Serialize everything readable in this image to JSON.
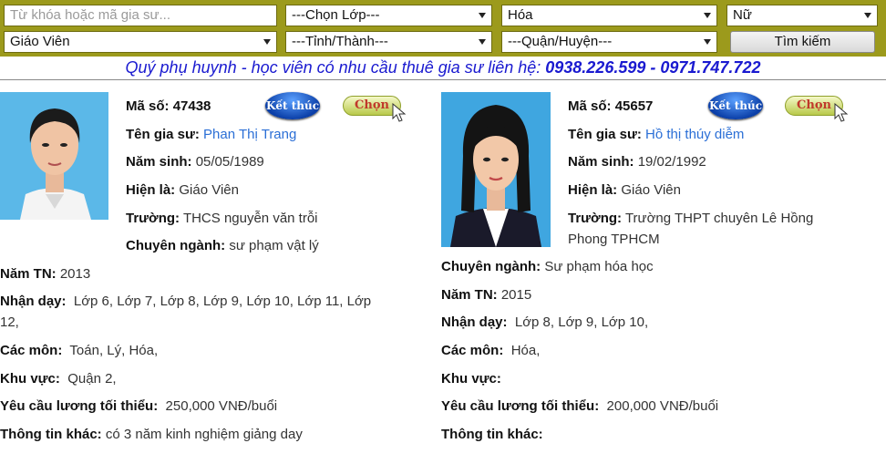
{
  "search": {
    "keyword_placeholder": "Từ khóa hoặc mã gia sư...",
    "grade_select": "---Chọn Lớp---",
    "subject_select": "Hóa",
    "gender_select": "Nữ",
    "role_select": "Giáo Viên",
    "province_select": "---Tỉnh/Thành---",
    "district_select": "---Quận/Huyện---",
    "search_button": "Tìm kiếm"
  },
  "hotline": {
    "text": "Quý phụ huynh - học viên có nhu cầu thuê gia sư liên hệ: ",
    "phones": "0938.226.599 - 0971.747.722"
  },
  "labels": {
    "code": "Mã số:",
    "name": "Tên gia sư:",
    "birth": "Năm sinh:",
    "current": "Hiện là:",
    "school": "Trường:",
    "major": "Chuyên ngành:",
    "grad_year": "Năm TN:",
    "grades": "Nhận dạy:",
    "subjects": "Các môn:",
    "area": "Khu vực:",
    "salary": "Yêu cầu lương tối thiểu:",
    "other": "Thông tin khác:",
    "end_badge": "Kết thúc",
    "choose_button": "Chọn"
  },
  "tutors": [
    {
      "code": "47438",
      "name": "Phan Thị Trang",
      "birth": "05/05/1989",
      "current": "Giáo Viên",
      "school": "THCS nguyễn văn trỗi",
      "major": "sư phạm vật lý",
      "grad_year": "2013",
      "grades_line1": "Lớp 6, Lớp 7, Lớp 8, Lớp 9, Lớp 10, Lớp 11, Lớp",
      "grades_line2": "12,",
      "subjects": "Toán, Lý, Hóa,",
      "area": "Quận 2,",
      "salary": "250,000 VNĐ/buổi",
      "other": "có 3 năm kinh nghiệm giảng day"
    },
    {
      "code": "45657",
      "name": "Hồ thị thúy diễm",
      "birth": "19/02/1992",
      "current": "Giáo Viên",
      "school_line1": "Trường THPT chuyên Lê Hồng",
      "school_line2": "Phong TPHCM",
      "major": "Sư phạm hóa học",
      "grad_year": "2015",
      "grades": "Lớp 8, Lớp 9, Lớp 10,",
      "subjects": "Hóa,",
      "area": "",
      "salary": "200,000 VNĐ/buổi",
      "other": ""
    }
  ],
  "colors": {
    "searchbar_bg": "#9c9a1c",
    "hotline": "#1a1ad0",
    "name_link": "#2b6fd6",
    "photo_bg_1": "#5bb8e8",
    "photo_bg_2": "#3fa6e0"
  }
}
